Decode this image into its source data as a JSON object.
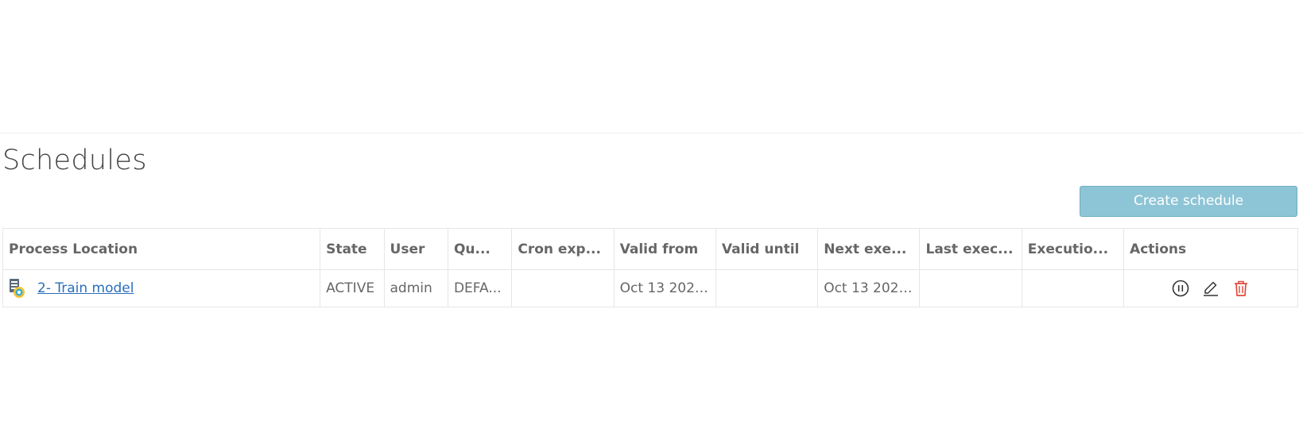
{
  "page": {
    "title": "Schedules",
    "create_button_label": "Create schedule"
  },
  "table": {
    "headers": {
      "process_location": "Process Location",
      "state": "State",
      "user": "User",
      "queue": "Qu...",
      "cron": "Cron exp...",
      "valid_from": "Valid from",
      "valid_until": "Valid until",
      "next_exec": "Next exe...",
      "last_exec": "Last exec...",
      "execution": "Executio...",
      "actions": "Actions"
    },
    "rows": [
      {
        "process_location": "2- Train model",
        "state": "ACTIVE",
        "user": "admin",
        "queue": "DEFA...",
        "cron": "",
        "valid_from": "Oct 13 2020 ...",
        "valid_until": "",
        "next_exec": "Oct 13 2020 ...",
        "last_exec": "",
        "execution": "",
        "actions": [
          "pause-icon",
          "edit-icon",
          "delete-icon"
        ]
      }
    ]
  },
  "colors": {
    "button_bg": "#8ec5d6",
    "link": "#2a6ebb",
    "delete": "#e04a3a"
  }
}
